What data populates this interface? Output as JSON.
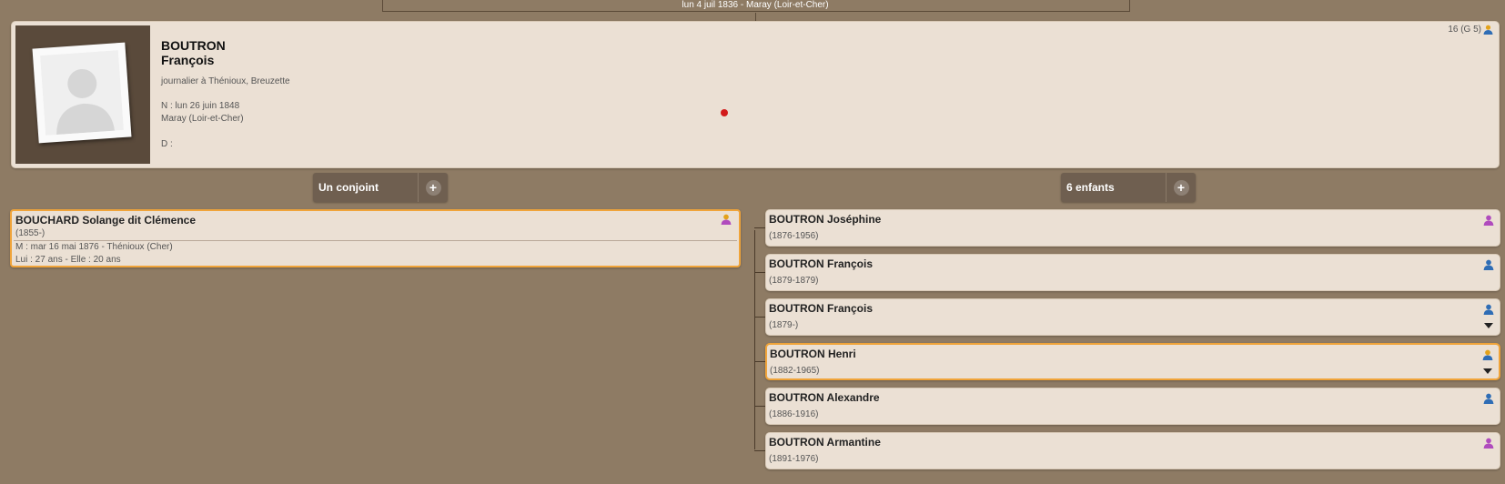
{
  "parents": {
    "marriage": "lun 4 juil 1836 - Maray (Loir-et-Cher)"
  },
  "person": {
    "surname": "BOUTRON",
    "given": "François",
    "occupation": "journalier à Thénioux, Breuzette",
    "birth_date": "N : lun 26 juin 1848",
    "birth_place": "Maray (Loir-et-Cher)",
    "death": "D :",
    "sosa": "16 (G 5)",
    "sosa_icon": "person-gold-icon"
  },
  "spouses_group": {
    "label": "Un conjoint",
    "add": "+"
  },
  "children_group": {
    "label": "6 enfants",
    "add": "+"
  },
  "spouse": {
    "name": "BOUCHARD Solange dit Clémence",
    "dates": "(1855-)",
    "marriage": "M : mar 16 mai 1876 - Thénioux (Cher)",
    "ages": "Lui : 27 ans - Elle : 20 ans",
    "icon": "person-gold-icon",
    "icon_color": "#e3a21a"
  },
  "children": [
    {
      "name": "BOUTRON Joséphine",
      "dates": "(1876-1956)",
      "icon": "person-female-icon",
      "icon_color": "#b04bbd",
      "selected": false,
      "expand": false
    },
    {
      "name": "BOUTRON François",
      "dates": "(1879-1879)",
      "icon": "person-male-icon",
      "icon_color": "#2f6db5",
      "selected": false,
      "expand": false
    },
    {
      "name": "BOUTRON François",
      "dates": "(1879-)",
      "icon": "person-male-icon",
      "icon_color": "#2f6db5",
      "selected": false,
      "expand": true
    },
    {
      "name": "BOUTRON Henri",
      "dates": "(1882-1965)",
      "icon": "person-gold-icon",
      "icon_color": "#e3a21a",
      "selected": true,
      "expand": true
    },
    {
      "name": "BOUTRON Alexandre",
      "dates": "(1886-1916)",
      "icon": "person-male-icon",
      "icon_color": "#2f6db5",
      "selected": false,
      "expand": false
    },
    {
      "name": "BOUTRON Armantine",
      "dates": "(1891-1976)",
      "icon": "person-female-icon",
      "icon_color": "#b04bbd",
      "selected": false,
      "expand": false
    }
  ]
}
